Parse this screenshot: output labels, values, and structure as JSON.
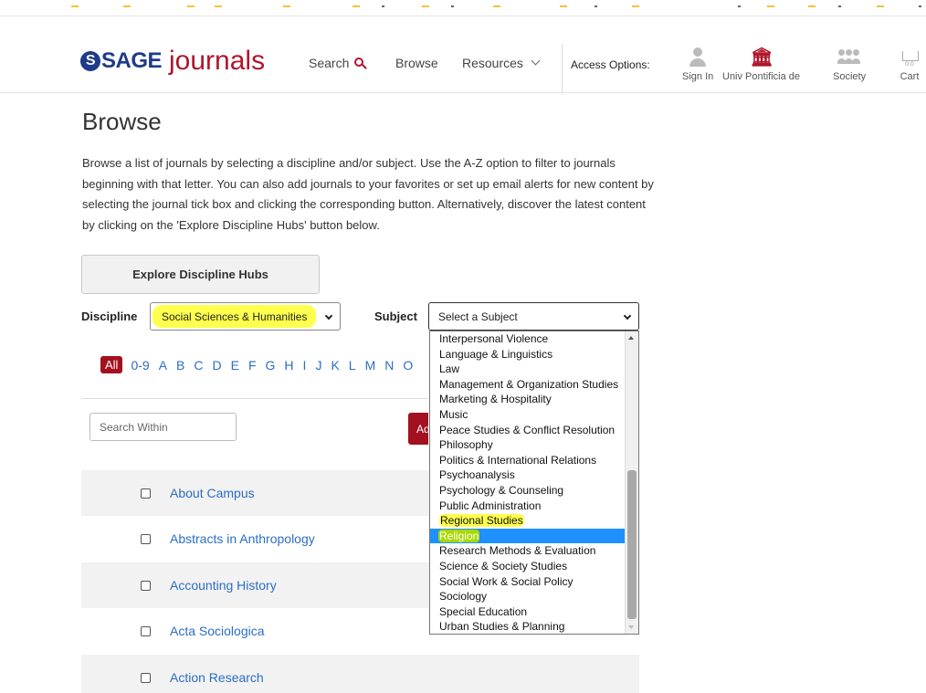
{
  "header": {
    "logo_sage": "SAGE",
    "logo_journals": "journals",
    "nav": {
      "search": "Search",
      "browse": "Browse",
      "resources": "Resources"
    },
    "access_options": "Access Options:",
    "icons": {
      "sign_in": "Sign In",
      "institution": "Univ Pontificia de",
      "society": "Society",
      "cart": "Cart"
    }
  },
  "main": {
    "title": "Browse",
    "intro": "Browse a list of journals by selecting a discipline and/or subject. Use the A-Z option to filter to journals beginning with that letter. You can also add journals to your favorites or set up email alerts for new content by selecting the journal tick box and clicking the corresponding button. Alternatively, discover the latest content by clicking on the 'Explore Discipline Hubs' button below.",
    "explore_button": "Explore Discipline Hubs",
    "discipline_label": "Discipline",
    "discipline_value": "Social Sciences & Humanities",
    "subject_label": "Subject",
    "subject_value": "Select a Subject",
    "az": {
      "all": "All",
      "letters": [
        "0-9",
        "A",
        "B",
        "C",
        "D",
        "E",
        "F",
        "G",
        "H",
        "I",
        "J",
        "K",
        "L",
        "M",
        "N",
        "O"
      ]
    },
    "search_within_placeholder": "Search Within",
    "add_button": "Ad",
    "journals": [
      "About Campus",
      "Abstracts in Anthropology",
      "Accounting History",
      "Acta Sociologica",
      "Action Research"
    ]
  },
  "subject_dropdown": {
    "options": [
      "Interpersonal Violence",
      "Language & Linguistics",
      "Law",
      "Management & Organization Studies",
      "Marketing & Hospitality",
      "Music",
      "Peace Studies & Conflict Resolution",
      "Philosophy",
      "Politics & International Relations",
      "Psychoanalysis",
      "Psychology & Counseling",
      "Public Administration",
      "Regional Studies",
      "Religion",
      "Research Methods & Evaluation",
      "Science & Society Studies",
      "Social Work & Social Policy",
      "Sociology",
      "Special Education",
      "Urban Studies & Planning"
    ],
    "highlighted_option": "Religion",
    "marked_option": "Regional Studies"
  },
  "colors": {
    "brand_red": "#a3101f",
    "brand_blue": "#1e3a8a",
    "link_blue": "#2a6fc4",
    "highlight_yellow": "#ffff4d",
    "selection_blue": "#1e90ff"
  }
}
